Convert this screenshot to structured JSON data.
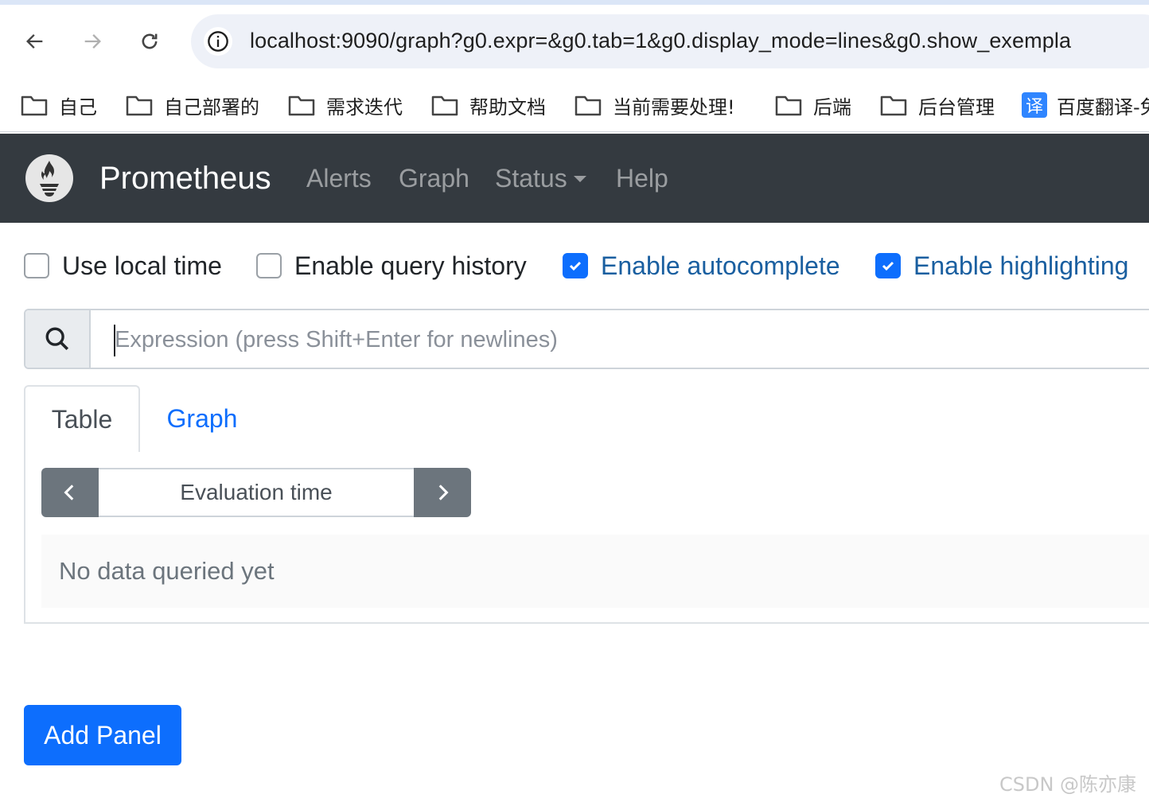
{
  "browser": {
    "url": "localhost:9090/graph?g0.expr=&g0.tab=1&g0.display_mode=lines&g0.show_exempla",
    "bookmarks": [
      {
        "label": "自己",
        "icon": "folder-icon"
      },
      {
        "label": "自己部署的",
        "icon": "folder-icon"
      },
      {
        "label": "需求迭代",
        "icon": "folder-icon"
      },
      {
        "label": "帮助文档",
        "icon": "folder-icon"
      },
      {
        "label": "当前需要处理!",
        "icon": "folder-icon"
      },
      {
        "label": "后端",
        "icon": "folder-icon"
      },
      {
        "label": "后台管理",
        "icon": "folder-icon"
      },
      {
        "label": "百度翻译-免",
        "icon": "translate-icon",
        "icon_text": "译"
      }
    ]
  },
  "navbar": {
    "brand": "Prometheus",
    "links": [
      "Alerts",
      "Graph",
      "Status",
      "Help"
    ]
  },
  "options": [
    {
      "label": "Use local time",
      "checked": false
    },
    {
      "label": "Enable query history",
      "checked": false
    },
    {
      "label": "Enable autocomplete",
      "checked": true
    },
    {
      "label": "Enable highlighting",
      "checked": true
    }
  ],
  "expression": {
    "placeholder": "Expression (press Shift+Enter for newlines)",
    "value": ""
  },
  "tabs": [
    "Table",
    "Graph"
  ],
  "active_tab": "Table",
  "table": {
    "eval_placeholder": "Evaluation time",
    "empty_message": "No data queried yet"
  },
  "add_panel_label": "Add Panel",
  "watermark": "CSDN @陈亦康",
  "colors": {
    "navbar_bg": "#343a40",
    "primary": "#0d6efd",
    "secondary": "#6c757d"
  }
}
